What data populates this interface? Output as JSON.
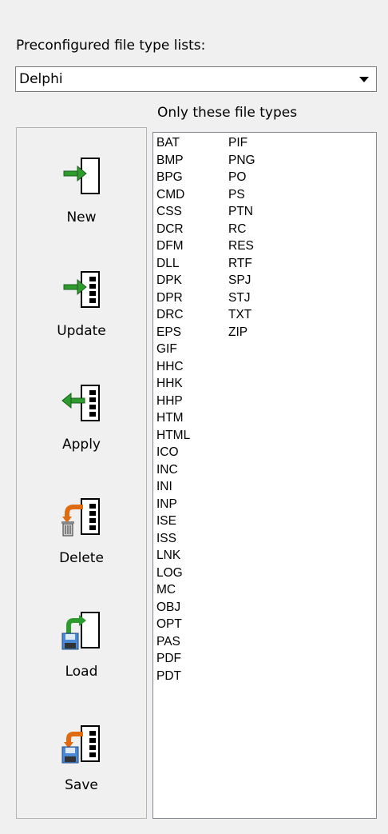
{
  "preconfigured_label": "Preconfigured file type lists:",
  "preconfigured_value": "Delphi",
  "only_label": "Only these file types",
  "buttons": {
    "new": "New",
    "update": "Update",
    "apply": "Apply",
    "delete": "Delete",
    "load": "Load",
    "save": "Save"
  },
  "file_types_col1": [
    "BAT",
    "BMP",
    "BPG",
    "CMD",
    "CSS",
    "DCR",
    "DFM",
    "DLL",
    "DPK",
    "DPR",
    "DRC",
    "EPS",
    "GIF",
    "HHC",
    "HHK",
    "HHP",
    "HTM",
    "HTML",
    "ICO",
    "INC",
    "INI",
    "INP",
    "ISE",
    "ISS",
    "LNK",
    "LOG",
    "MC",
    "OBJ",
    "OPT",
    "PAS",
    "PDF",
    "PDT"
  ],
  "file_types_col2": [
    "PIF",
    "PNG",
    "PO",
    "PS",
    "PTN",
    "RC",
    "RES",
    "RTF",
    "SPJ",
    "STJ",
    "TXT",
    "ZIP"
  ],
  "colors": {
    "arrow_green": "#2e9b2e",
    "arrow_orange": "#e06a10",
    "disk_blue": "#4a8ad4"
  }
}
